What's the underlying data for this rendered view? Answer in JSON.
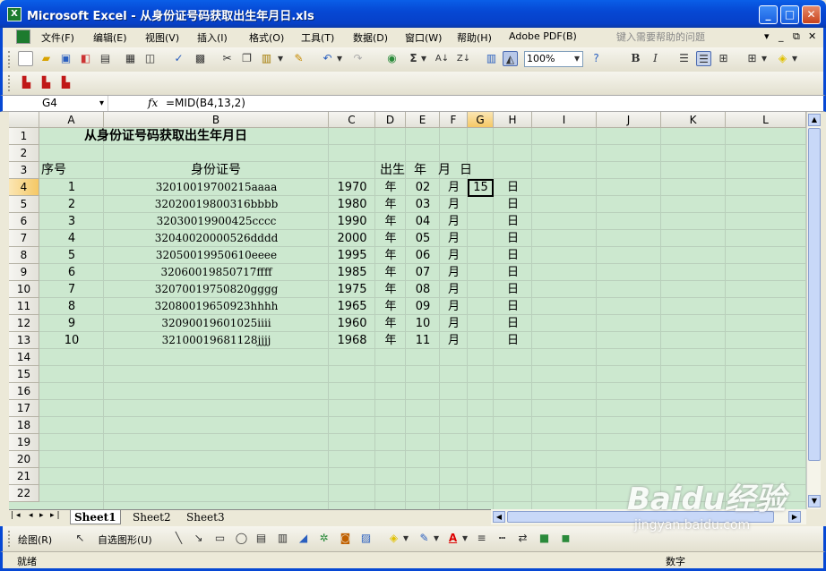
{
  "app": {
    "title": "Microsoft Excel - 从身份证号码获取出生年月日.xls",
    "icon": "excel-icon"
  },
  "window_buttons": {
    "minimize": "_",
    "maximize": "□",
    "close": "✕"
  },
  "menu": {
    "items": [
      "文件(F)",
      "编辑(E)",
      "视图(V)",
      "插入(I)",
      "格式(O)",
      "工具(T)",
      "数据(D)",
      "窗口(W)",
      "帮助(H)",
      "Adobe PDF(B)"
    ],
    "help_placeholder": "键入需要帮助的问题"
  },
  "toolbar": {
    "zoom": "100%",
    "bold": "B",
    "italic": "I"
  },
  "formula_bar": {
    "name_box": "G4",
    "fx": "fx",
    "formula": "=MID(B4,13,2)"
  },
  "columns": [
    "A",
    "B",
    "C",
    "D",
    "E",
    "F",
    "G",
    "H",
    "I",
    "J",
    "K",
    "L"
  ],
  "rows": [
    "1",
    "2",
    "3",
    "4",
    "5",
    "6",
    "7",
    "8",
    "9",
    "10",
    "11",
    "12",
    "13",
    "14",
    "15",
    "16",
    "17",
    "18",
    "19",
    "20",
    "21",
    "22"
  ],
  "sheet": {
    "title": "从身份证号码获取出生年月日",
    "headers": {
      "seq": "序号",
      "id": "身份证号",
      "birth": "出生",
      "year": "年",
      "month": "月",
      "day": "日"
    },
    "data": [
      {
        "seq": "1",
        "id": "32010019700215aaaa",
        "year": "1970",
        "y": "年",
        "month": "02",
        "m": "月",
        "day": "15",
        "d": "日"
      },
      {
        "seq": "2",
        "id": "32020019800316bbbb",
        "year": "1980",
        "y": "年",
        "month": "03",
        "m": "月",
        "day": "",
        "d": "日"
      },
      {
        "seq": "3",
        "id": "32030019900425cccc",
        "year": "1990",
        "y": "年",
        "month": "04",
        "m": "月",
        "day": "",
        "d": "日"
      },
      {
        "seq": "4",
        "id": "32040020000526dddd",
        "year": "2000",
        "y": "年",
        "month": "05",
        "m": "月",
        "day": "",
        "d": "日"
      },
      {
        "seq": "5",
        "id": "32050019950610eeee",
        "year": "1995",
        "y": "年",
        "month": "06",
        "m": "月",
        "day": "",
        "d": "日"
      },
      {
        "seq": "6",
        "id": "32060019850717ffff",
        "year": "1985",
        "y": "年",
        "month": "07",
        "m": "月",
        "day": "",
        "d": "日"
      },
      {
        "seq": "7",
        "id": "32070019750820gggg",
        "year": "1975",
        "y": "年",
        "month": "08",
        "m": "月",
        "day": "",
        "d": "日"
      },
      {
        "seq": "8",
        "id": "32080019650923hhhh",
        "year": "1965",
        "y": "年",
        "month": "09",
        "m": "月",
        "day": "",
        "d": "日"
      },
      {
        "seq": "9",
        "id": "32090019601025iiii",
        "year": "1960",
        "y": "年",
        "month": "10",
        "m": "月",
        "day": "",
        "d": "日"
      },
      {
        "seq": "10",
        "id": "32100019681128jjjj",
        "year": "1968",
        "y": "年",
        "month": "11",
        "m": "月",
        "day": "",
        "d": "日"
      }
    ]
  },
  "sheet_tabs": [
    "Sheet1",
    "Sheet2",
    "Sheet3"
  ],
  "drawing": {
    "draw": "绘图(R)",
    "autoshape": "自选图形(U)"
  },
  "status": {
    "left": "就绪",
    "right": "数字"
  },
  "watermark": {
    "text": "Baidu经验",
    "sub": "jingyan.baidu.com"
  },
  "colors": {
    "cell_bg": "#cce8cf",
    "titlebar": "#0648d4"
  }
}
